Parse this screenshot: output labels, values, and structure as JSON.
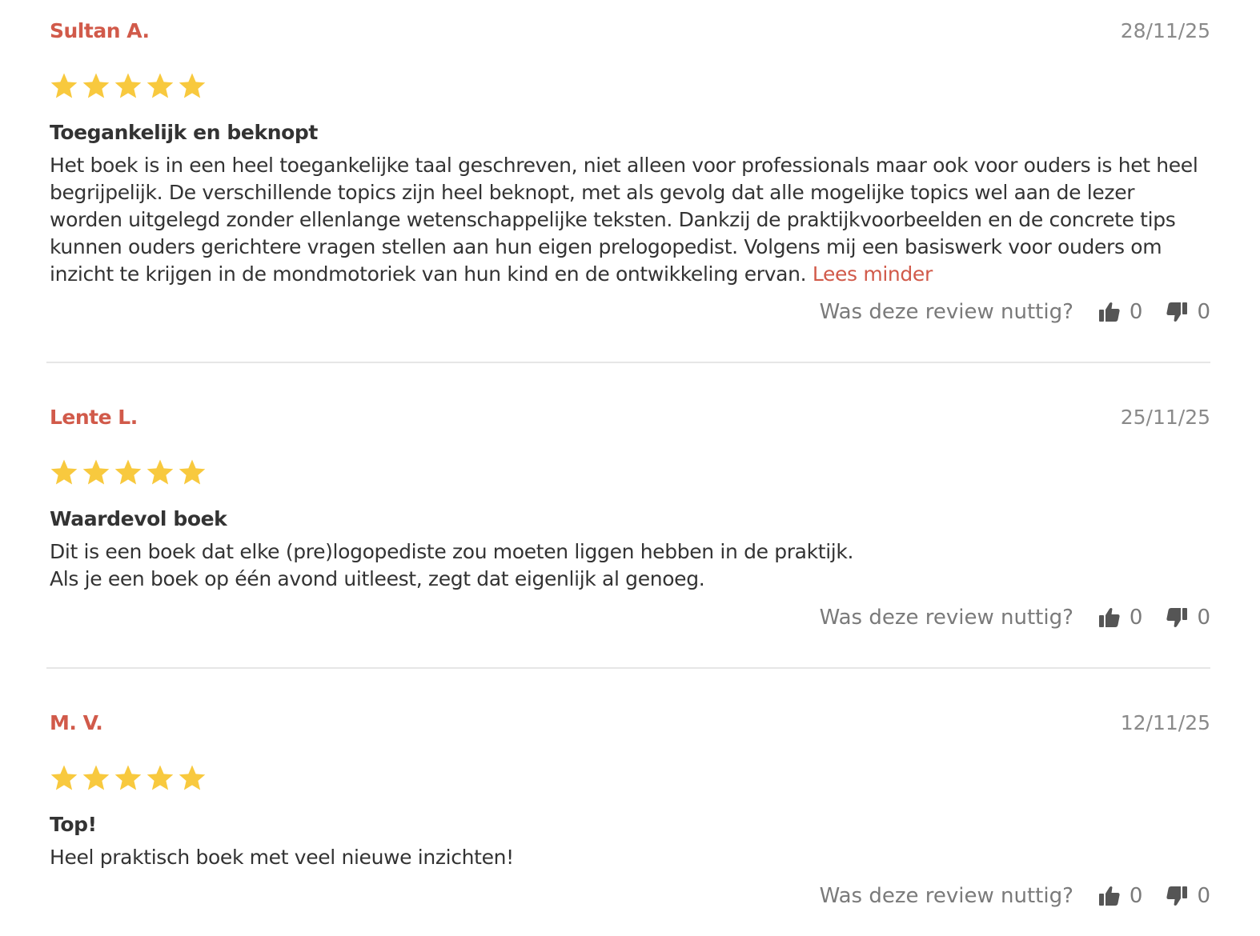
{
  "colors": {
    "accent": "#d15a4a",
    "star": "#f8c93e",
    "muted": "#8a8a8a",
    "text": "#333333"
  },
  "icons": {
    "star": "star-icon",
    "thumbs_up": "thumbs-up-icon",
    "thumbs_down": "thumbs-down-icon"
  },
  "reviews": [
    {
      "author": "Sultan A.",
      "date": "28/11/25",
      "rating": 5,
      "max_rating": 5,
      "title": "Toegankelijk en beknopt",
      "body": "Het boek is in een heel toegankelijke taal geschreven, niet alleen voor professionals maar ook voor ouders is het heel begrijpelijk. De verschillende topics zijn heel beknopt, met als gevolg dat alle mogelijke topics wel aan de lezer worden uitgelegd zonder ellenlange wetenschappelijke teksten. Dankzij de praktijkvoorbeelden en de concrete tips kunnen ouders gerichtere vragen stellen aan hun eigen prelogopedist. Volgens mij een basiswerk voor ouders om inzicht te krijgen in de mondmotoriek van hun kind en de ontwikkeling ervan.",
      "read_more_label": "Lees minder",
      "helpful_question": "Was deze review nuttig?",
      "upvotes": "0",
      "downvotes": "0"
    },
    {
      "author": "Lente L.",
      "date": "25/11/25",
      "rating": 5,
      "max_rating": 5,
      "title": "Waardevol boek",
      "body_lines": [
        "Dit is een boek dat elke (pre)logopediste zou moeten liggen hebben in de praktijk.",
        "Als je een boek op één avond uitleest, zegt dat eigenlijk al genoeg."
      ],
      "helpful_question": "Was deze review nuttig?",
      "upvotes": "0",
      "downvotes": "0"
    },
    {
      "author": "M. V.",
      "date": "12/11/25",
      "rating": 5,
      "max_rating": 5,
      "title": "Top!",
      "body": "Heel praktisch boek met veel nieuwe inzichten!",
      "helpful_question": "Was deze review nuttig?",
      "upvotes": "0",
      "downvotes": "0"
    }
  ]
}
